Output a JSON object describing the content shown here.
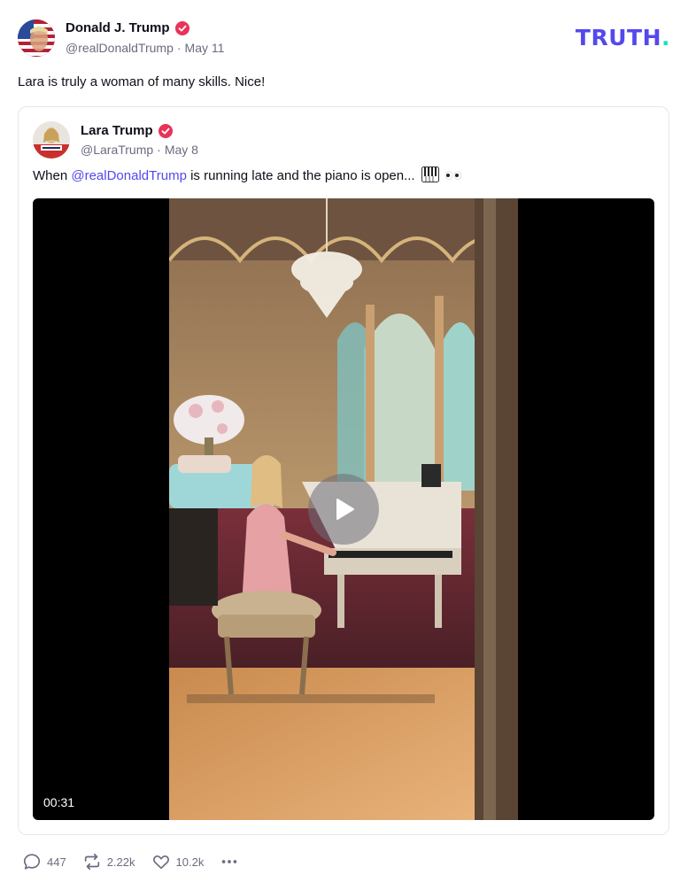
{
  "post": {
    "author": {
      "display_name": "Donald J. Trump",
      "handle": "@realDonaldTrump",
      "date": "May 11"
    },
    "separator": "·",
    "text": "Lara is truly a woman of many skills. Nice!",
    "brand": {
      "logo_text": "TRUTH",
      "logo_dot": "."
    }
  },
  "quoted": {
    "author": {
      "display_name": "Lara Trump",
      "handle": "@LaraTrump",
      "date": "May 8"
    },
    "separator": "·",
    "text_before": "When ",
    "mention": "@realDonaldTrump",
    "text_after": " is running late and the piano is open...",
    "video": {
      "duration": "00:31"
    }
  },
  "actions": {
    "replies": "447",
    "retruths": "2.22k",
    "likes": "10.2k"
  },
  "colors": {
    "accent": "#5448ee",
    "brand_dot": "#17e2c7",
    "verified": "#e8335a",
    "muted": "#6b6b80"
  },
  "icons": [
    "verified-badge-icon",
    "piano-emoji-icon",
    "eyes-emoji-icon",
    "play-icon",
    "reply-icon",
    "retruth-icon",
    "like-icon",
    "more-icon"
  ]
}
